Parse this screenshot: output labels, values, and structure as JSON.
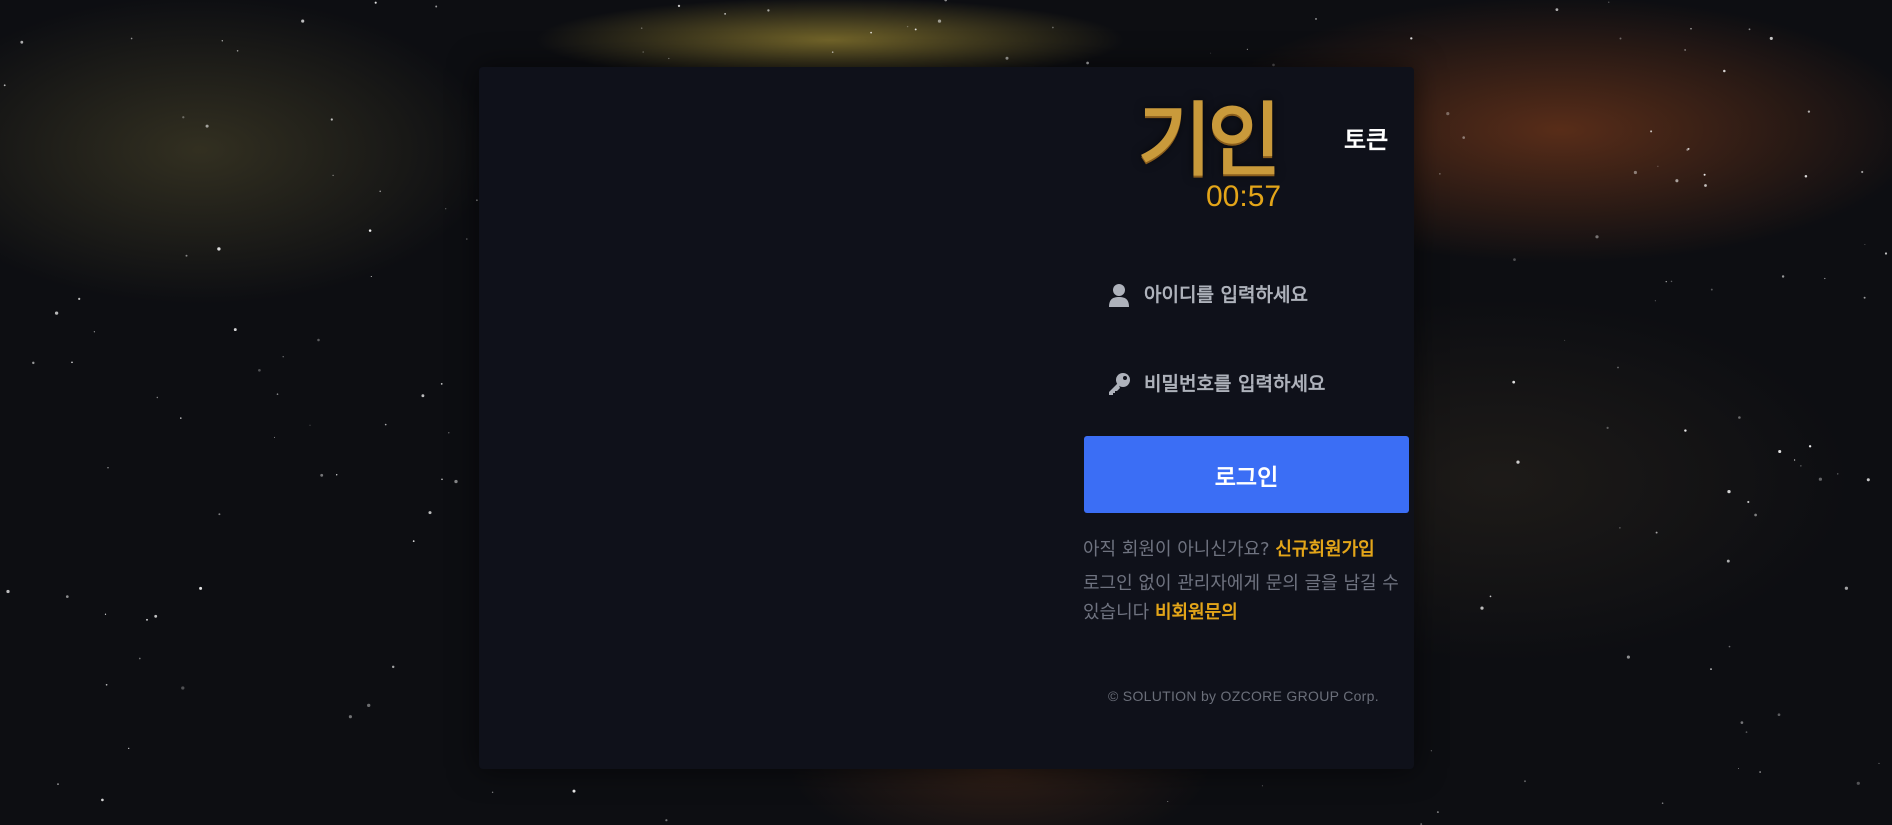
{
  "brand": {
    "logo_text": "기인",
    "timer": "00:57"
  },
  "header": {
    "token_label": "토큰"
  },
  "form": {
    "id_placeholder": "아이디를 입력하세요",
    "password_placeholder": "비밀번호를 입력하세요",
    "login_label": "로그인"
  },
  "signup": {
    "prompt": "아직 회원이 아니신가요?",
    "link": "신규회원가입"
  },
  "guest": {
    "prompt": "로그인 없이 관리자에게 문의 글을 남길 수 있습니다",
    "link": "비회원문의"
  },
  "footer": {
    "copyright": "© SOLUTION by OZCORE GROUP Corp."
  },
  "icons": {
    "id": "user-icon",
    "password": "key-icon"
  },
  "colors": {
    "accent": "#e3a519",
    "button": "#3b6ef5",
    "panel": "#0f111a"
  }
}
